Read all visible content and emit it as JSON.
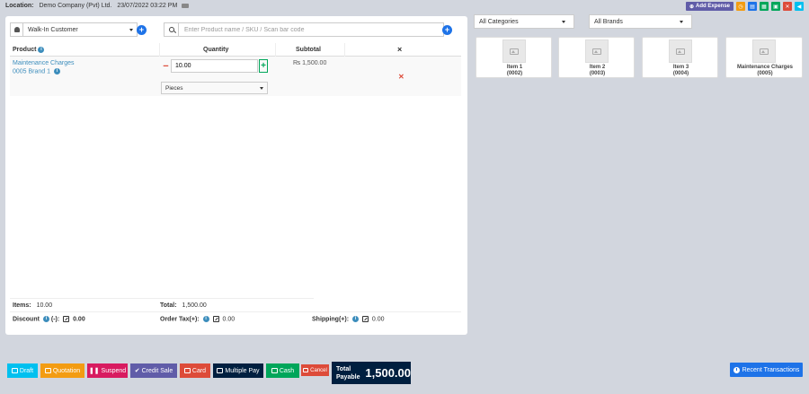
{
  "location": {
    "label": "Location:",
    "business": "Demo Company (Pvt) Ltd.",
    "datetime": "23/07/2022 03:22 PM"
  },
  "top_actions": {
    "add_expense": "Add Expense"
  },
  "customer": {
    "selected": "Walk-In Customer"
  },
  "search": {
    "placeholder": "Enter Product name / SKU / Scan bar code"
  },
  "table": {
    "headers": {
      "product": "Product",
      "quantity": "Quantity",
      "subtotal": "Subtotal",
      "remove": "×"
    },
    "rows": [
      {
        "name": "Maintenance Charges",
        "sku_brand": "0005 Brand 1",
        "quantity": "10.00",
        "unit": "Pieces",
        "subtotal": "₨ 1,500.00"
      }
    ]
  },
  "totals": {
    "items_label": "Items:",
    "items_value": "10.00",
    "total_label": "Total:",
    "total_value": "1,500.00",
    "discount_label": "Discount",
    "discount_suffix": "(-):",
    "discount_value": "0.00",
    "tax_label": "Order Tax(+):",
    "tax_value": "0.00",
    "shipping_label": "Shipping(+):",
    "shipping_value": "0.00"
  },
  "filters": {
    "categories": "All Categories",
    "brands": "All Brands"
  },
  "products": [
    {
      "name": "Item 1",
      "sku": "(0002)"
    },
    {
      "name": "Item 2",
      "sku": "(0003)"
    },
    {
      "name": "Item 3",
      "sku": "(0004)"
    },
    {
      "name": "Maintenance Charges",
      "sku": "(0005)"
    }
  ],
  "bottom": {
    "draft": "Draft",
    "quotation": "Quotation",
    "suspend": "Suspend",
    "credit_sale": "Credit Sale",
    "card": "Card",
    "multiple_pay": "Multiple Pay",
    "cash": "Cash",
    "cancel": "Cancel",
    "total_payable_label": "Total Payable",
    "total_payable_value": "1,500.00",
    "recent_transactions": "Recent Transactions"
  },
  "colors": {
    "draft": "#00c0ef",
    "quotation": "#f39c12",
    "suspend": "#d81b60",
    "credit_sale": "#605ca8",
    "card": "#dd4b39",
    "multiple_pay": "#001f3f",
    "cash": "#00a65a",
    "cancel": "#dd4b39",
    "accent": "#1e73e8",
    "link": "#3c8dbc"
  }
}
